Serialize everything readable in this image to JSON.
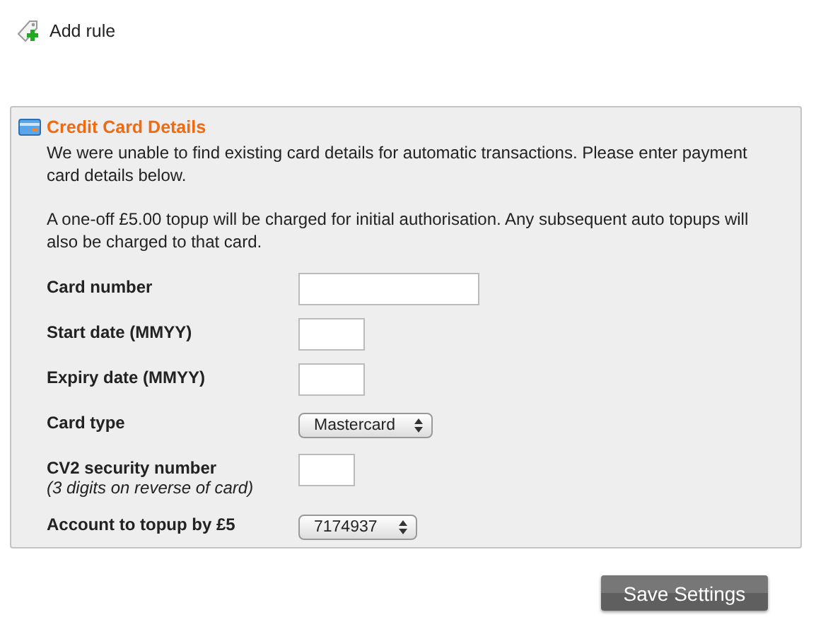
{
  "toolbar": {
    "add_rule": "Add rule"
  },
  "panel": {
    "title": "Credit Card Details",
    "paragraphs": [
      "We were unable to find existing card details for automatic transactions. Please enter payment card details below.",
      "A one-off £5.00 topup will be charged for initial authorisation. Any subsequent auto topups will also be charged to that card."
    ],
    "fields": [
      {
        "label": "Card number",
        "kind": "text"
      },
      {
        "label": "Start date (MMYY)",
        "kind": "date"
      },
      {
        "label": "Expiry date (MMYY)",
        "kind": "date"
      },
      {
        "label": "Card type",
        "kind": "select",
        "value": "Mastercard"
      },
      {
        "label": "CV2 security number",
        "note": "(3 digits on reverse of card)",
        "kind": "code"
      },
      {
        "label": "Account to topup by £5",
        "kind": "select",
        "value": "7174937"
      }
    ]
  },
  "buttons": [
    "Save Settings"
  ]
}
